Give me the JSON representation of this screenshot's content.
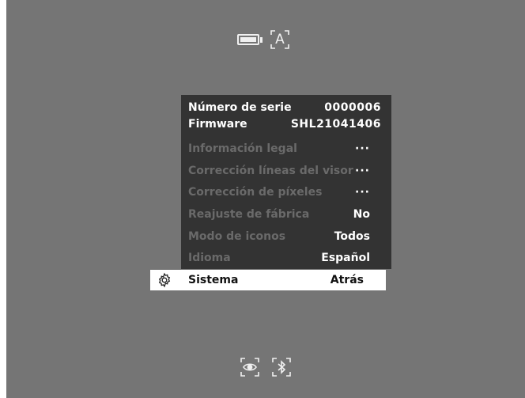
{
  "status": {
    "battery_icon": "battery-icon",
    "auto_mode_label": "A"
  },
  "menu": {
    "serial_label": "Número de serie",
    "serial_value": "0000006",
    "firmware_label": "Firmware",
    "firmware_value": "SHL21041406",
    "items": [
      {
        "label": "Información legal",
        "value": "···"
      },
      {
        "label": "Corrección líneas del visor",
        "value": "···"
      },
      {
        "label": "Corrección de píxeles",
        "value": "···"
      },
      {
        "label": "Reajuste de fábrica",
        "value": "No"
      },
      {
        "label": "Modo de iconos",
        "value": "Todos"
      },
      {
        "label": "Idioma",
        "value": "Español"
      }
    ],
    "selected": {
      "label": "Sistema",
      "value": "Atrás",
      "icon": "gear-icon"
    }
  },
  "bottom": {
    "icons": [
      "eye-icon",
      "bluetooth-icon"
    ]
  }
}
